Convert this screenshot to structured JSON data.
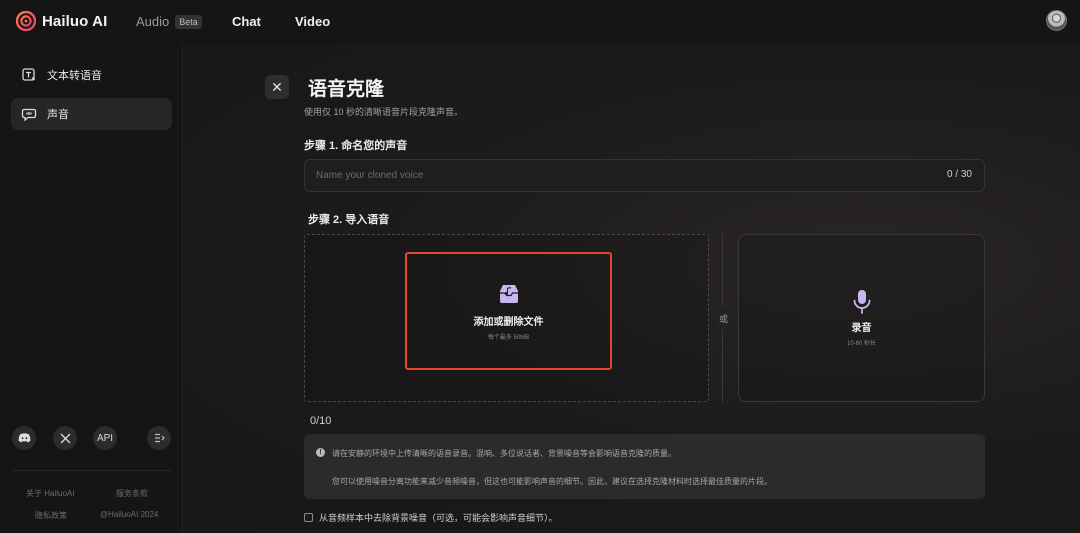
{
  "topbar": {
    "brand": "Hailuo AI",
    "nav_audio": "Audio",
    "nav_audio_badge": "Beta",
    "nav_chat": "Chat",
    "nav_video": "Video"
  },
  "sidebar": {
    "items": [
      {
        "label": "文本转语音",
        "icon": "text-to-speech-icon",
        "active": false
      },
      {
        "label": "声音",
        "icon": "voice-bubble-icon",
        "active": true
      }
    ],
    "social": {
      "discord_icon": "discord-icon",
      "x_icon": "x-logo-icon",
      "api_label": "API",
      "collapse_icon": "collapse-sidebar-icon"
    },
    "footer": {
      "about": "关于 HailuoAI",
      "terms": "服务条款",
      "privacy": "隐私政策",
      "copyright": "@HailuoAI 2024"
    }
  },
  "main": {
    "close_symbol": "✕",
    "title": "语音克隆",
    "subtitle": "使用仅 10 秒的清晰语音片段克隆声音。",
    "step1_label": "步骤 1. 命名您的声音",
    "name_placeholder": "Name your cloned voice",
    "name_value": "",
    "name_counter": "0 / 30",
    "step2_label": "步骤 2. 导入语音",
    "upload": {
      "label": "添加或删除文件",
      "limit": "每个最多 50MB",
      "icon": "inbox-music-icon"
    },
    "or_text": "或",
    "record": {
      "label": "录音",
      "range": "10-60 秒长",
      "icon": "microphone-icon"
    },
    "file_count": "0/10",
    "notice": {
      "icon": "info-icon",
      "line1": "请在安静的环境中上传清晰的语音录音。混响、多位说话者、背景噪音等会影响语音克隆的质量。",
      "line2": "您可以使用噪音分离功能来减少音频噪音，但这也可能影响声音的细节。因此，建议在选择克隆材料时选择最佳质量的片段。"
    },
    "denoise_label": "从音频样本中去除背景噪音（可选，可能会影响声音细节）。",
    "denoise_checked": false
  },
  "colors": {
    "background": "#141414",
    "highlight_border": "#e5452c",
    "mic_accent": "#c8b6f0",
    "brand_gradient_start": "#ff6a3d",
    "brand_gradient_end": "#e23c7a"
  }
}
